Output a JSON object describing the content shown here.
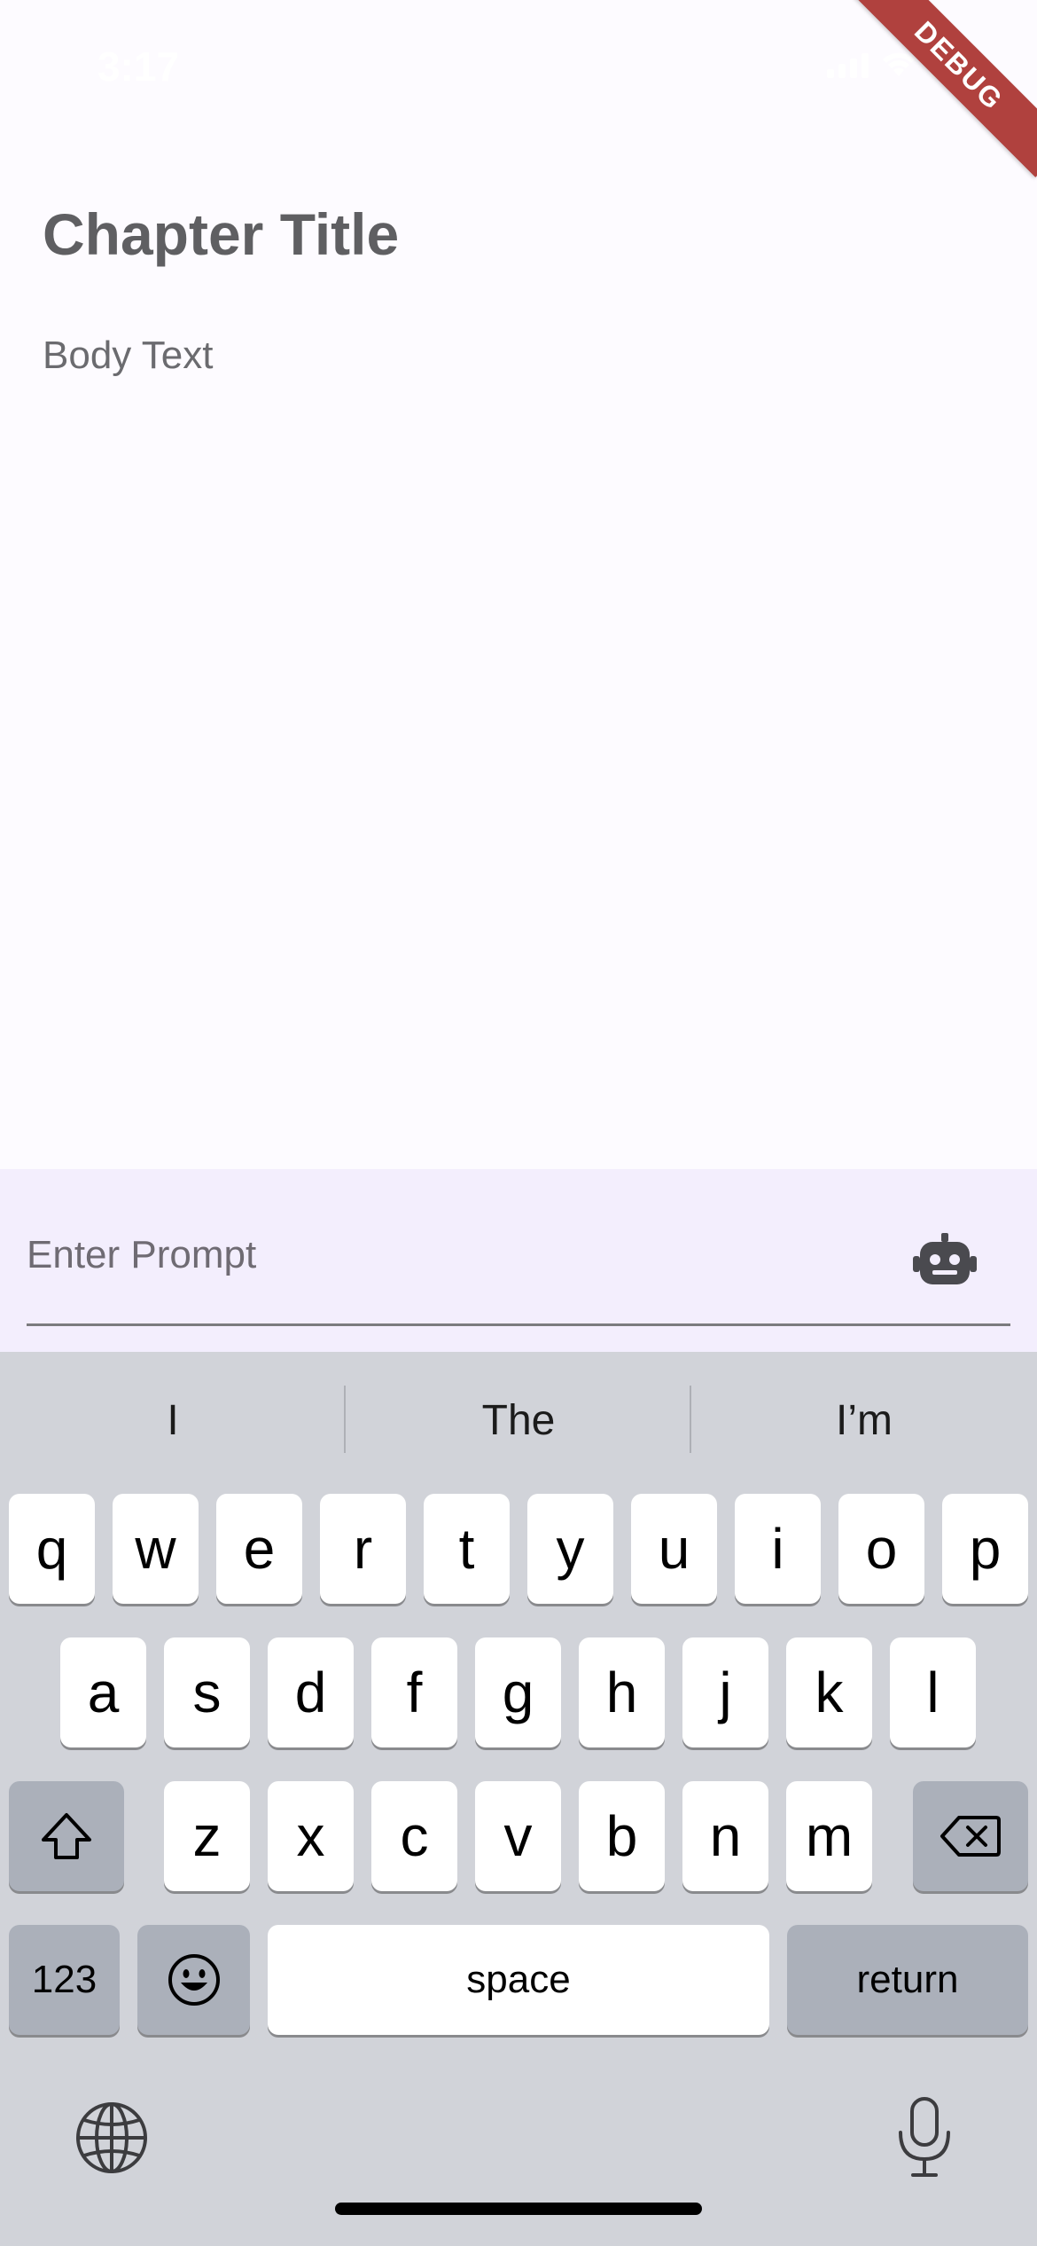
{
  "status_bar": {
    "time": "3:17"
  },
  "debug_banner": "DEBUG",
  "content": {
    "chapter_title": "Chapter Title",
    "body_text": "Body Text"
  },
  "prompt": {
    "placeholder": "Enter Prompt",
    "value": ""
  },
  "keyboard": {
    "suggestions": [
      "I",
      "The",
      "I’m"
    ],
    "row1": [
      "q",
      "w",
      "e",
      "r",
      "t",
      "y",
      "u",
      "i",
      "o",
      "p"
    ],
    "row2": [
      "a",
      "s",
      "d",
      "f",
      "g",
      "h",
      "j",
      "k",
      "l"
    ],
    "row3": [
      "z",
      "x",
      "c",
      "v",
      "b",
      "n",
      "m"
    ],
    "numbers_label": "123",
    "space_label": "space",
    "return_label": "return"
  }
}
